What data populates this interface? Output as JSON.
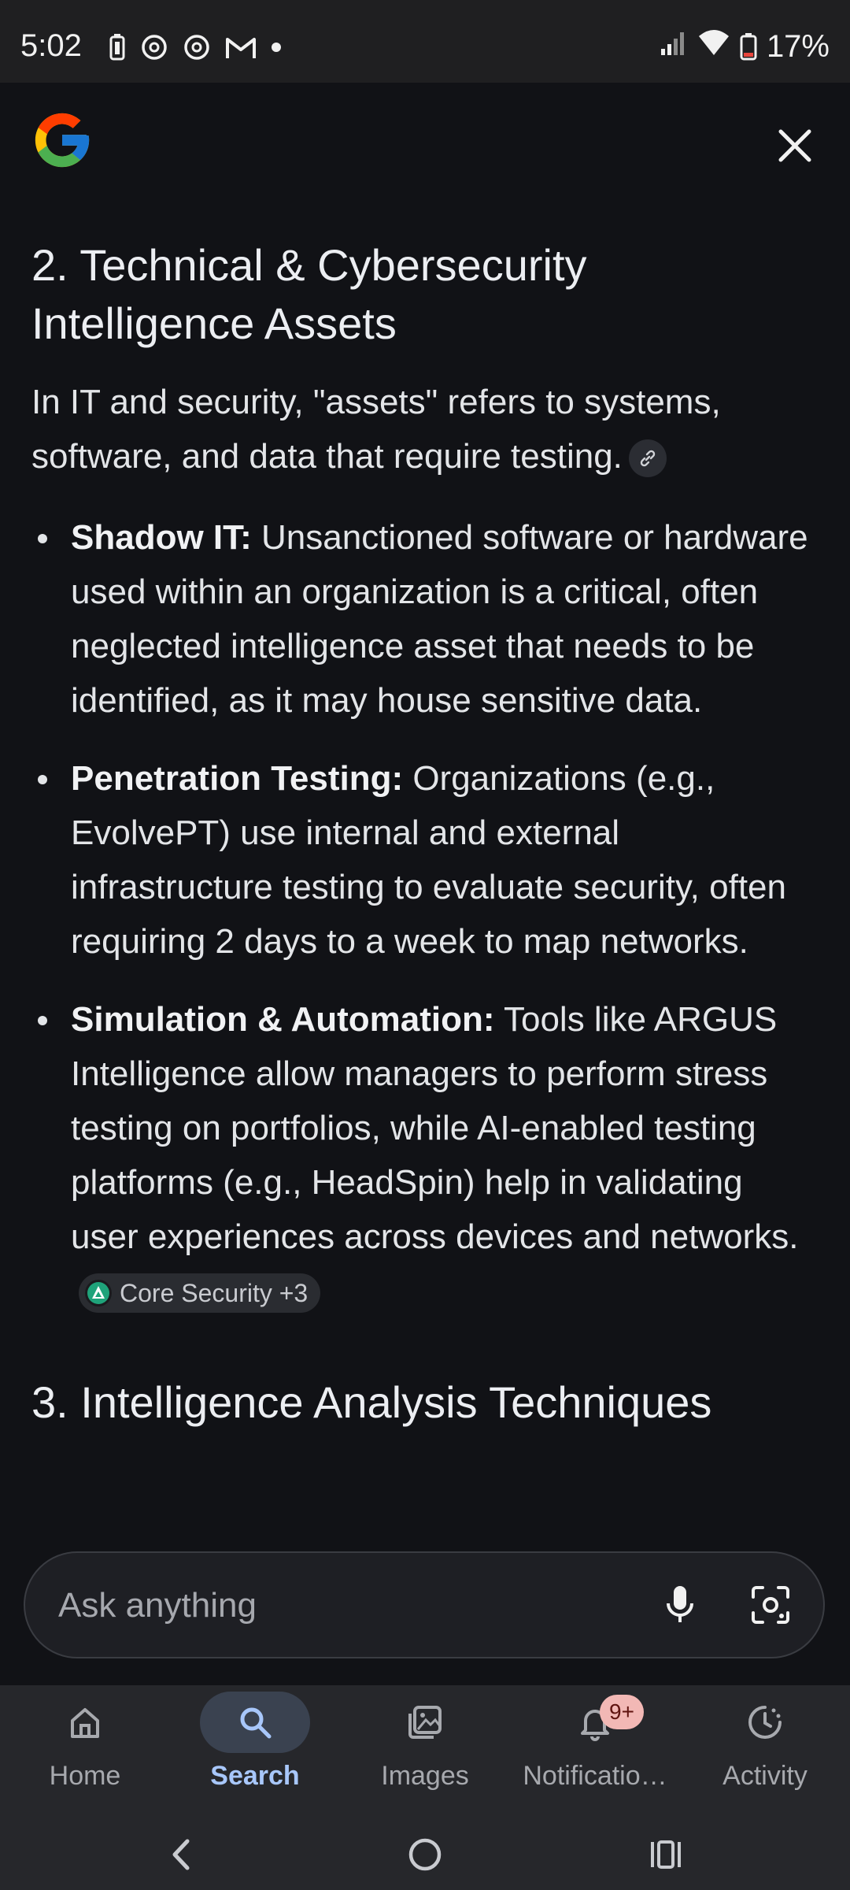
{
  "status_bar": {
    "time": "5:02",
    "notification_icons": [
      "battery-saver-icon",
      "threads-icon",
      "threads-icon",
      "gmail-icon",
      "dot-icon"
    ],
    "battery_percent": "17%"
  },
  "header": {
    "logo": "google-g-logo",
    "close_icon": "close-icon"
  },
  "content": {
    "section_title": "2. Technical & Cybersecurity Intelligence Assets",
    "intro": "In IT and security, \"assets\" refers to systems, software, and data that require testing.",
    "bullets": [
      {
        "term": "Shadow IT:",
        "text": " Unsanctioned software or hardware used within an organization is a critical, often neglected intelligence asset that needs to be identified, as it may house sensitive data."
      },
      {
        "term": "Penetration Testing:",
        "text": " Organizations (e.g., EvolvePT) use internal and external infrastructure testing to evaluate security, often requiring 2 days to a week to map networks."
      },
      {
        "term": "Simulation & Automation:",
        "text": " Tools like ARGUS Intelligence allow managers to perform stress testing on portfolios, while AI-enabled testing platforms (e.g., HeadSpin) help in validating user experiences across devices and networks.",
        "source_chip": "Core Security +3"
      }
    ],
    "next_section_title": "3. Intelligence Analysis Techniques"
  },
  "ask_bar": {
    "placeholder": "Ask anything"
  },
  "bottom_nav": {
    "items": [
      {
        "label": "Home",
        "icon": "home-icon"
      },
      {
        "label": "Search",
        "icon": "search-icon",
        "active": true
      },
      {
        "label": "Images",
        "icon": "images-icon"
      },
      {
        "label": "Notificatio…",
        "icon": "bell-icon",
        "badge": "9+"
      },
      {
        "label": "Activity",
        "icon": "activity-icon"
      }
    ]
  },
  "colors": {
    "background": "#111216",
    "active_accent": "#a8c7fa",
    "badge": "#f2b8b5"
  }
}
